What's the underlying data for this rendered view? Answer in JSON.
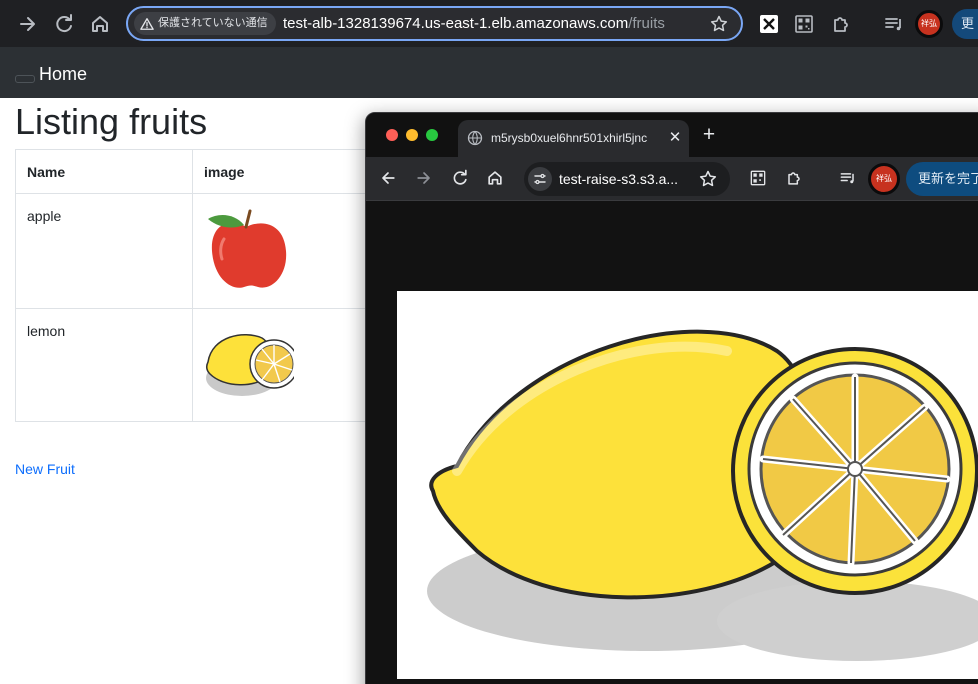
{
  "browser": {
    "security_chip": "保護されていない通信",
    "url_host": "test-alb-1328139674.us-east-1.elb.amazonaws.com",
    "url_path": "/fruits",
    "profile_initials": "祥弘",
    "update_label": "更"
  },
  "navbar": {
    "home_label": "Home"
  },
  "page": {
    "title": "Listing fruits",
    "columns": [
      "Name",
      "image"
    ],
    "rows": [
      {
        "name": "apple",
        "image": "apple"
      },
      {
        "name": "lemon",
        "image": "lemon"
      }
    ],
    "new_link": "New Fruit"
  },
  "popup": {
    "tab_title": "m5rysb0xuel6hnr501xhirl5jnc",
    "url": "test-raise-s3.s3.a...",
    "profile_initials": "祥弘",
    "update_label": "更新を完了",
    "image": "lemon"
  },
  "colors": {
    "link": "#0d6efd",
    "navbar": "#2c3034",
    "omnibox_focus": "#7aa7f5",
    "update_button": "#14497a"
  }
}
